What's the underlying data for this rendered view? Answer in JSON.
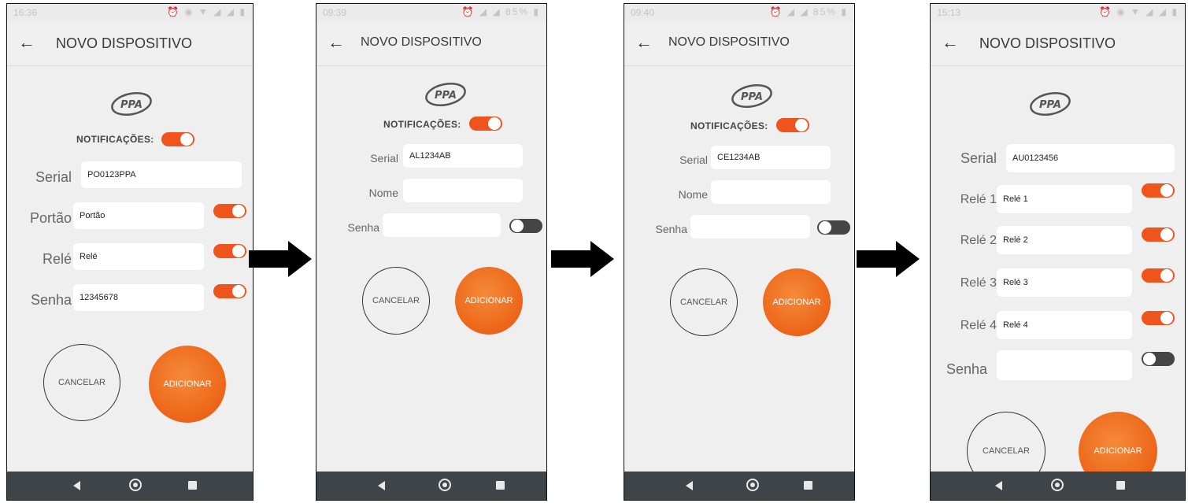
{
  "common": {
    "title": "NOVO DISPOSITIVO",
    "back_glyph": "←",
    "notifications_label": "NOTIFICAÇÕES:",
    "cancel_label": "CANCELAR",
    "add_label": "ADICIONAR",
    "accent_color": "#f0541d",
    "icons": [
      "back-arrow-icon",
      "ppa-logo",
      "nav-back-icon",
      "nav-home-icon",
      "nav-recent-icon",
      "flow-arrow-icon"
    ]
  },
  "screens": [
    {
      "status_time": "16:36",
      "status_icons": "⏰ ◉ ▼ ◢ ◢ ▮",
      "notifications": "on",
      "fields": [
        {
          "label": "Serial",
          "value": "PO0123PPA",
          "toggle": null
        },
        {
          "label": "Portão",
          "value": "Portão",
          "toggle": "on"
        },
        {
          "label": "Relé",
          "value": "Relé",
          "toggle": "on"
        },
        {
          "label": "Senha",
          "value": "12345678",
          "toggle": "on"
        }
      ]
    },
    {
      "status_time": "09:39",
      "status_icons": "⏰ ◢ ◢ 85% ▮",
      "notifications": "on",
      "fields": [
        {
          "label": "Serial",
          "value": "AL1234AB",
          "toggle": null
        },
        {
          "label": "Nome",
          "value": "",
          "toggle": null
        },
        {
          "label": "Senha",
          "value": "",
          "toggle": "off"
        }
      ]
    },
    {
      "status_time": "09:40",
      "status_icons": "⏰ ◢ ◢ 85% ▮",
      "notifications": "on",
      "fields": [
        {
          "label": "Serial",
          "value": "CE1234AB",
          "toggle": null
        },
        {
          "label": "Nome",
          "value": "",
          "toggle": null
        },
        {
          "label": "Senha",
          "value": "",
          "toggle": "off"
        }
      ]
    },
    {
      "status_time": "15:13",
      "status_icons": "⏰ ◉ ▼ ◢ ◢ ▮",
      "fields": [
        {
          "label": "Serial",
          "value": "AU0123456",
          "toggle": null
        },
        {
          "label": "Relé 1",
          "value": "Relé 1",
          "toggle": "on"
        },
        {
          "label": "Relé 2",
          "value": "Relé 2",
          "toggle": "on"
        },
        {
          "label": "Relé 3",
          "value": "Relé 3",
          "toggle": "on"
        },
        {
          "label": "Relé 4",
          "value": "Relé 4",
          "toggle": "on"
        },
        {
          "label": "Senha",
          "value": "",
          "toggle": "off"
        }
      ]
    }
  ]
}
